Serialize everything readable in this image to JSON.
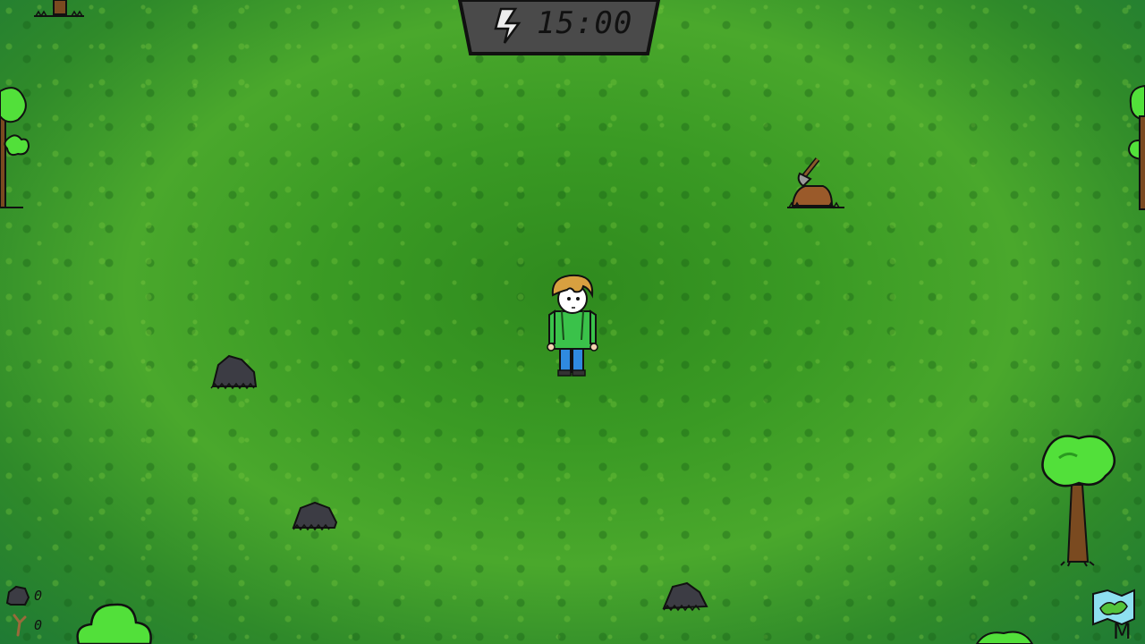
{
  "hud": {
    "timer": {
      "icon": "lightning-icon",
      "value": "15:00"
    },
    "resources": [
      {
        "icon": "stone-icon",
        "count": "0"
      },
      {
        "icon": "stick-icon",
        "count": "0"
      }
    ],
    "map_button": {
      "icon": "map-icon",
      "key_label": "M"
    }
  },
  "world": {
    "player": "player-character",
    "objects": [
      "tree",
      "tree",
      "tree",
      "tree",
      "tree",
      "axe-in-stump",
      "rock",
      "rock",
      "rock",
      "bush",
      "bush"
    ]
  },
  "colors": {
    "grass_dark": "#1f7a34",
    "grass_mid": "#3a9a24",
    "grass_light": "#6cc23a",
    "panel": "#4a4a4a",
    "rock": "#3c3c44",
    "foliage": "#52e03a",
    "trunk": "#7a4a20"
  }
}
